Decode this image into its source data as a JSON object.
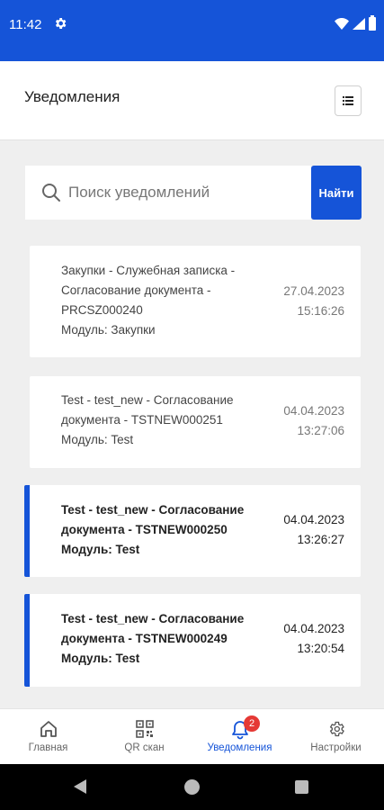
{
  "statusbar": {
    "time": "11:42"
  },
  "header": {
    "title": "Уведомления"
  },
  "search": {
    "placeholder": "Поиск уведомлений",
    "button_label": "Найти"
  },
  "notifications": [
    {
      "lines": [
        "Закупки - Служебная записка -",
        "Согласование документа -",
        "PRCSZ000240",
        "Модуль: Закупки"
      ],
      "date": "27.04.2023",
      "time": "15:16:26",
      "unread": false
    },
    {
      "lines": [
        "Test - test_new - Согласование",
        "документа - TSTNEW000251",
        "Модуль: Test"
      ],
      "date": "04.04.2023",
      "time": "13:27:06",
      "unread": false
    },
    {
      "lines": [
        "Test - test_new - Согласование",
        "документа - TSTNEW000250",
        "Модуль: Test"
      ],
      "date": "04.04.2023",
      "time": "13:26:27",
      "unread": true
    },
    {
      "lines": [
        "Test - test_new - Согласование",
        "документа - TSTNEW000249",
        "Модуль: Test"
      ],
      "date": "04.04.2023",
      "time": "13:20:54",
      "unread": true
    }
  ],
  "bottom_nav": [
    {
      "label": "Главная",
      "icon": "home-icon"
    },
    {
      "label": "QR скан",
      "icon": "qr-icon"
    },
    {
      "label": "Уведомления",
      "icon": "bell-icon",
      "badge": "2",
      "active": true
    },
    {
      "label": "Настройки",
      "icon": "gear-icon"
    }
  ],
  "colors": {
    "accent": "#1554d8",
    "badge": "#e53935",
    "background": "#efefef"
  }
}
